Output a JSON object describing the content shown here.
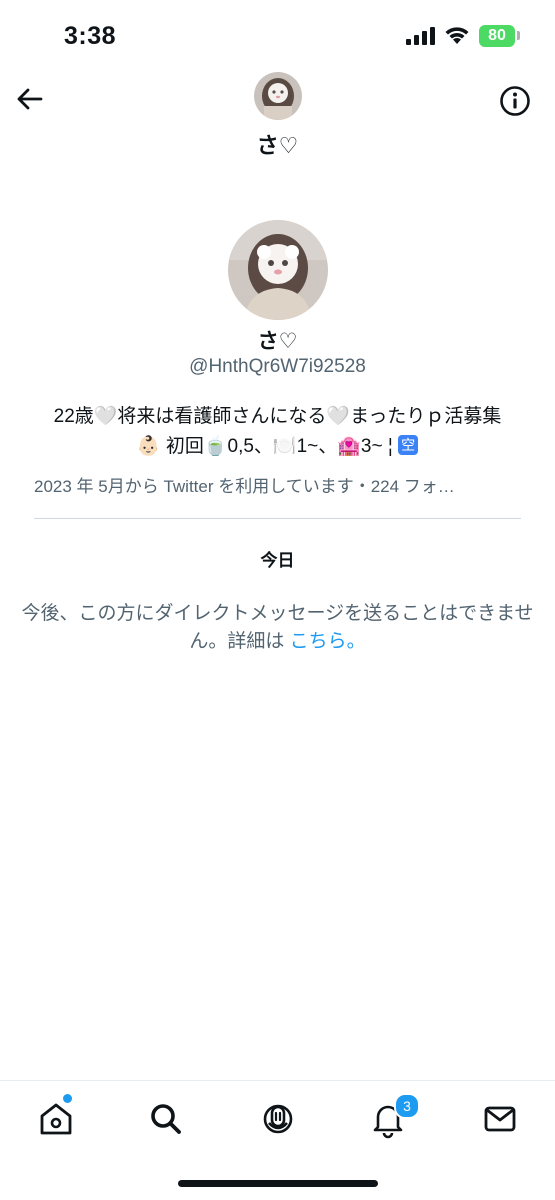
{
  "status_bar": {
    "time": "3:38",
    "battery": "80"
  },
  "header": {
    "name": "さ♡"
  },
  "profile": {
    "name": "さ♡",
    "handle": "@HnthQr6W7i92528",
    "bio_line1": "22歳🤍将来は看護師さんになる🤍まったりｐ活募集",
    "bio_line2_prefix": "👶🏻 初回🍵0,5、🍽️1~、🏩3~ ¦ ",
    "bio_badge": "空",
    "meta": "2023 年 5月から Twitter を利用しています・224 フォ…"
  },
  "conversation": {
    "date_label": "今日",
    "notice": "今後、この方にダイレクトメッセージを送ることはできません。詳細は ",
    "notice_link": "こちら。"
  },
  "bottom_nav": {
    "notifications_count": "3"
  },
  "colors": {
    "accent": "#1d9bf0",
    "text": "#0f1419",
    "secondary_text": "#536471",
    "battery": "#4cd964"
  },
  "icons": [
    "back-arrow-icon",
    "info-icon",
    "home-icon",
    "search-icon",
    "spaces-icon",
    "bell-icon",
    "envelope-icon",
    "signal-icon",
    "wifi-icon",
    "battery-icon"
  ]
}
